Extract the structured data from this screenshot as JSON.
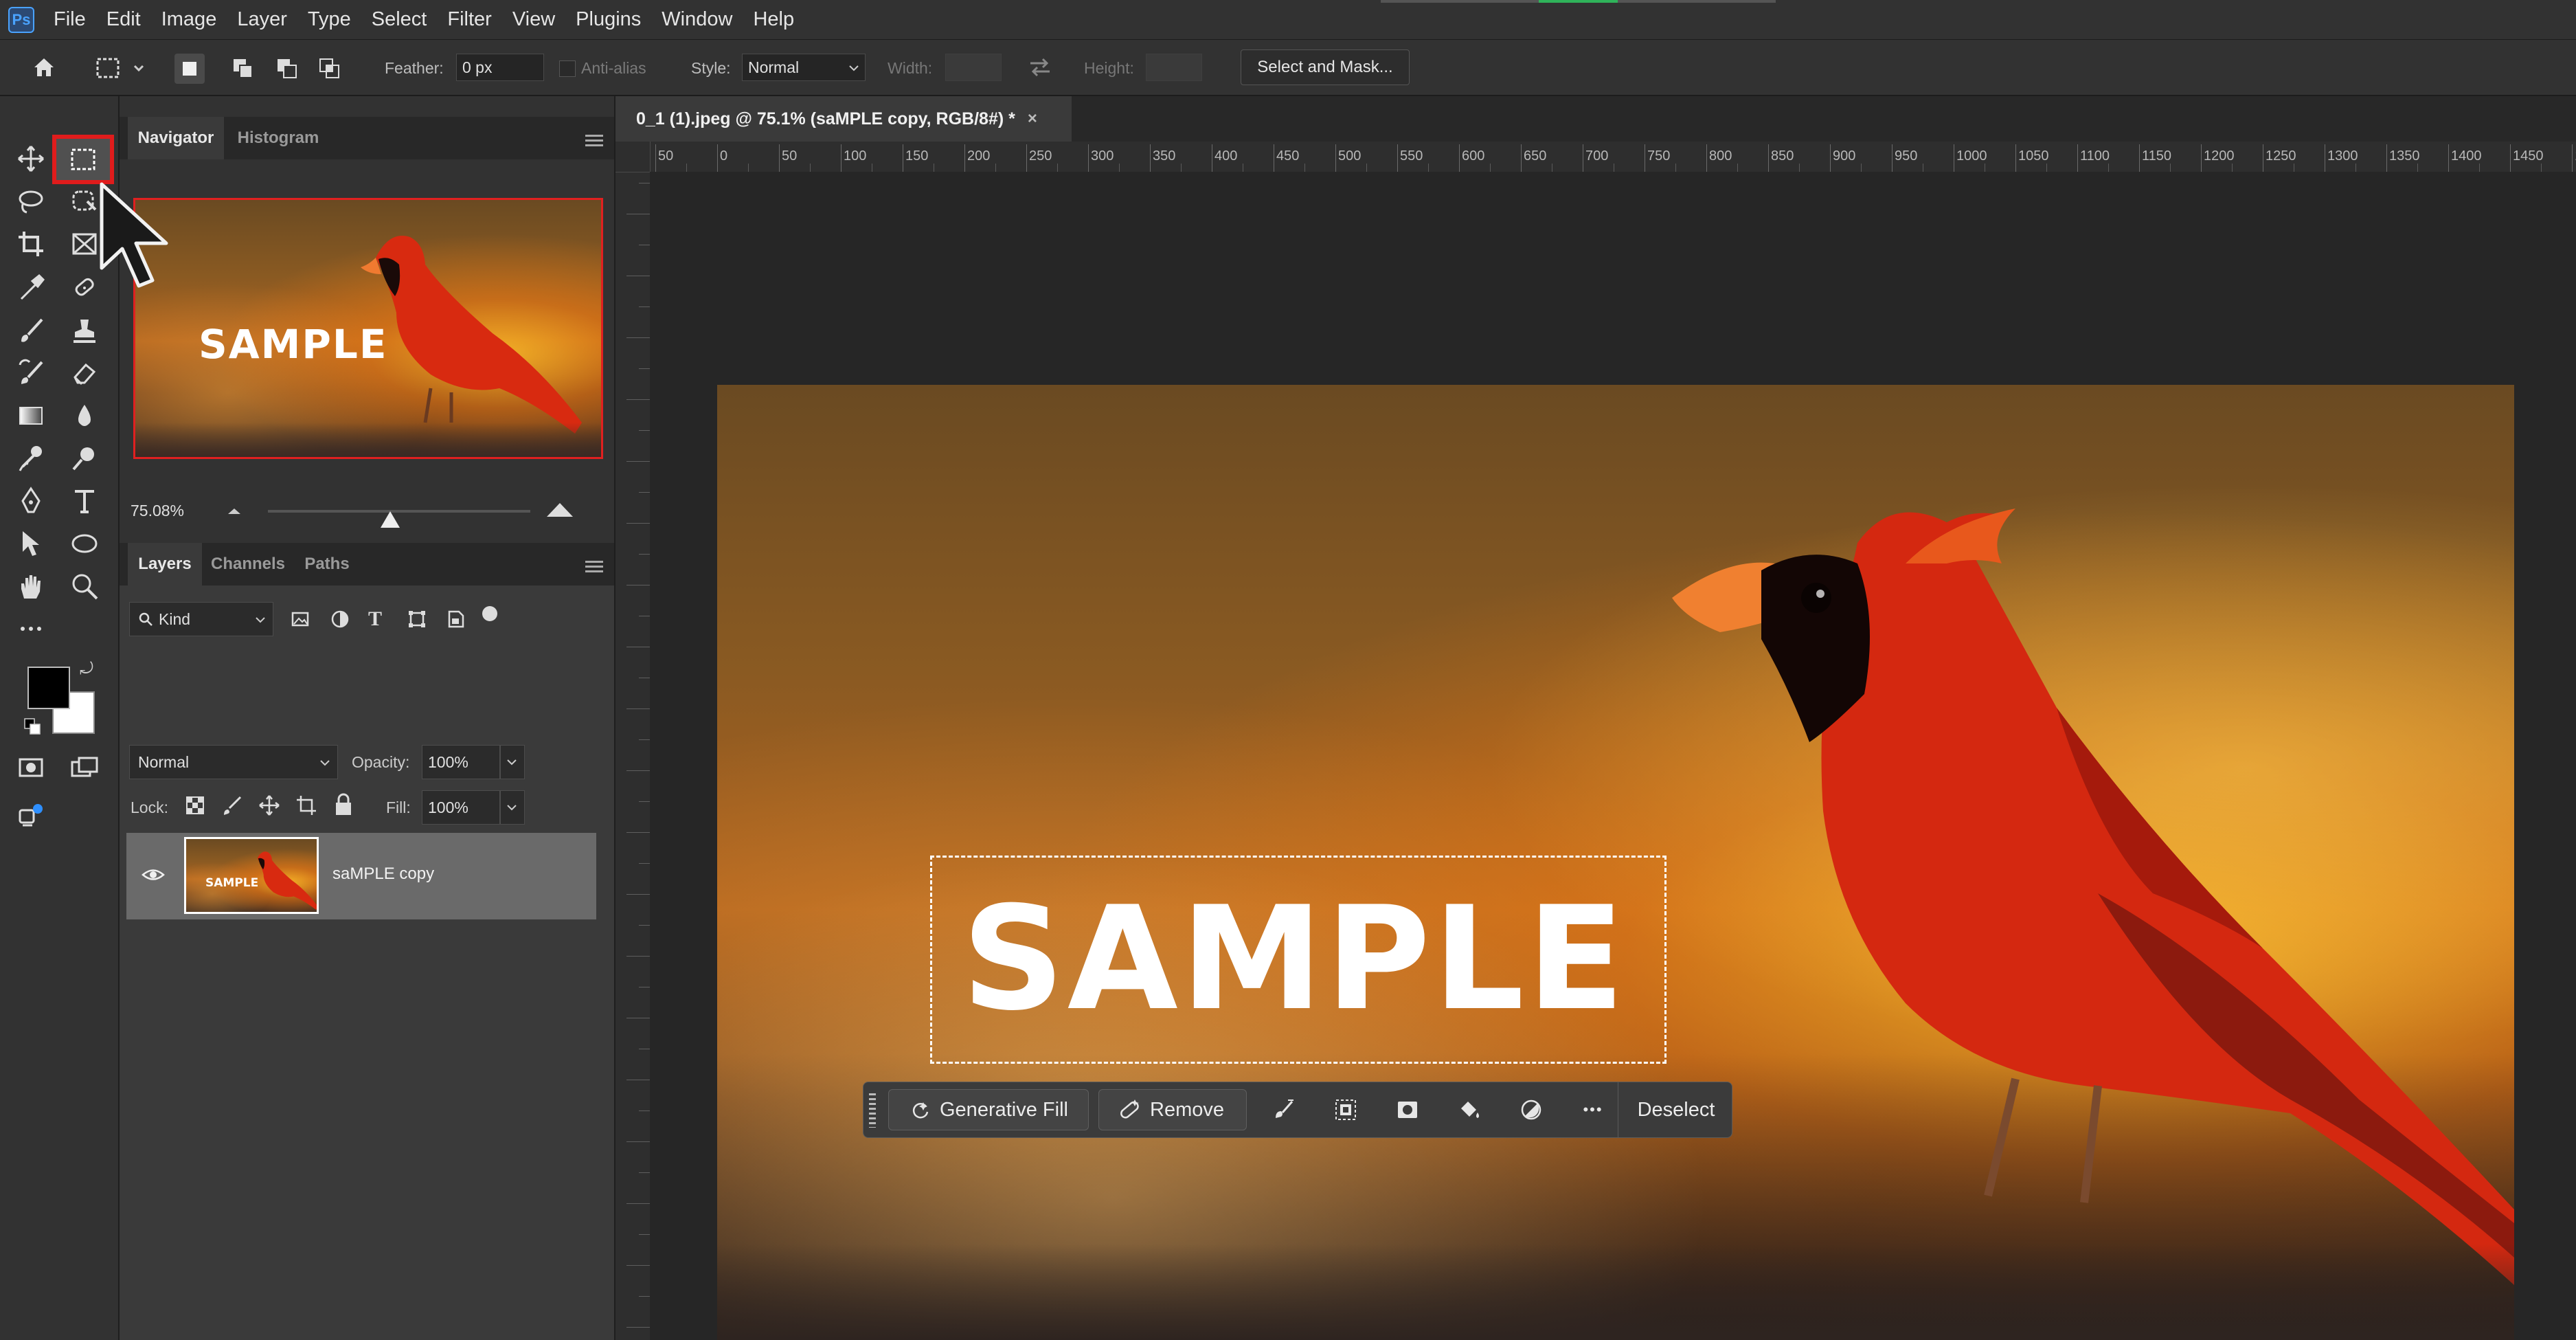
{
  "app": {
    "logo": "Ps"
  },
  "menu": [
    "File",
    "Edit",
    "Image",
    "Layer",
    "Type",
    "Select",
    "Filter",
    "View",
    "Plugins",
    "Window",
    "Help"
  ],
  "options": {
    "feather_label": "Feather:",
    "feather_value": "0 px",
    "antialias_label": "Anti-alias",
    "style_label": "Style:",
    "style_value": "Normal",
    "width_label": "Width:",
    "height_label": "Height:",
    "select_mask": "Select and Mask..."
  },
  "panels": {
    "navigator_tab": "Navigator",
    "histogram_tab": "Histogram",
    "zoom": "75.08%",
    "layers_tab": "Layers",
    "channels_tab": "Channels",
    "paths_tab": "Paths",
    "kind_filter": "Kind",
    "blend_mode": "Normal",
    "opacity_label": "Opacity:",
    "opacity_value": "100%",
    "lock_label": "Lock:",
    "fill_label": "Fill:",
    "fill_value": "100%",
    "layer_name": "saMPLE copy"
  },
  "document": {
    "tab_title": "0_1 (1).jpeg @ 75.1% (saMPLE copy, RGB/8#) *",
    "ruler_h": [
      "50",
      "0",
      "50",
      "100",
      "150",
      "200",
      "250",
      "300",
      "350",
      "400",
      "450",
      "500",
      "550",
      "600",
      "650",
      "700",
      "750",
      "800",
      "850",
      "900",
      "950",
      "1000",
      "1050",
      "1100",
      "1150",
      "1200",
      "1250",
      "1300",
      "1350",
      "1400",
      "1450",
      "15"
    ],
    "image_text": "SAMPLE",
    "thumb_text": "SAMPLE"
  },
  "taskbar": {
    "generative_fill": "Generative Fill",
    "remove": "Remove",
    "deselect": "Deselect",
    "more": "•••"
  },
  "colors": {
    "accent": "#4aa3ff",
    "highlight": "#e02020",
    "panel": "#323232",
    "canvas": "#262626"
  }
}
